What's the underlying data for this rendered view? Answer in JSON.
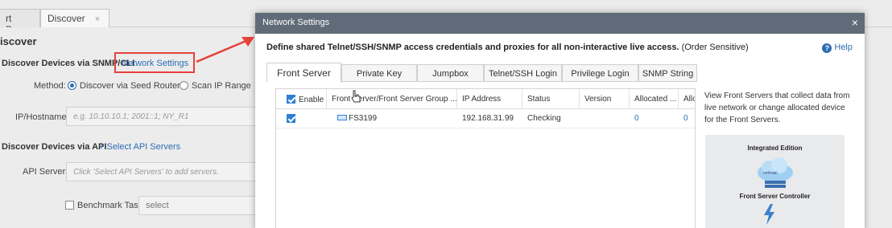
{
  "background": {
    "tabs": [
      {
        "label": "rt Page"
      },
      {
        "label": "Discover",
        "close": "×"
      }
    ],
    "title": "iscover",
    "snmp_section": "Discover Devices via SNMP/CLI",
    "network_settings_link": "Network Settings",
    "method_label": "Method:",
    "method_options": [
      "Discover via Seed Routers",
      "Scan IP Range"
    ],
    "ip_label": "IP/Hostname:",
    "ip_placeholder": "e.g. 10.10.10.1; 2001::1; NY_R1",
    "api_section": "Discover Devices via API",
    "select_api_link": "+ Select API Servers",
    "api_servers_label": "API Servers:",
    "api_servers_placeholder": "Click 'Select API Servers' to add servers.",
    "benchmark_label": "Benchmark Task:",
    "benchmark_select": "select",
    "annotation_color": "#e8413b"
  },
  "modal": {
    "title": "Network Settings",
    "close": "×",
    "description_bold": "Define shared Telnet/SSH/SNMP access credentials and proxies for all non-interactive live access.",
    "description_rest": " (Order Sensitive)",
    "help": "Help",
    "help_glyph": "?",
    "tabs": [
      "Front Server",
      "Private Key",
      "Jumpbox",
      "Telnet/SSH Login",
      "Privilege Login",
      "SNMP String"
    ],
    "table": {
      "headers": [
        "Enable",
        "Front Server/Front Server Group ...",
        "IP Address",
        "Status",
        "Version",
        "Allocated ...",
        "Allo"
      ],
      "rows": [
        {
          "name": "FS3199",
          "ip": "192.168.31.99",
          "status": "Checking",
          "version": "",
          "allocated1": "0",
          "allocated2": "0"
        }
      ]
    },
    "side_text": "View Front Servers that collect data from live network or change allocated device for the Front Servers.",
    "card_title": "Integrated Edition",
    "card_cloud_text": "netbrain",
    "card_caption": "Front Server Controller"
  }
}
